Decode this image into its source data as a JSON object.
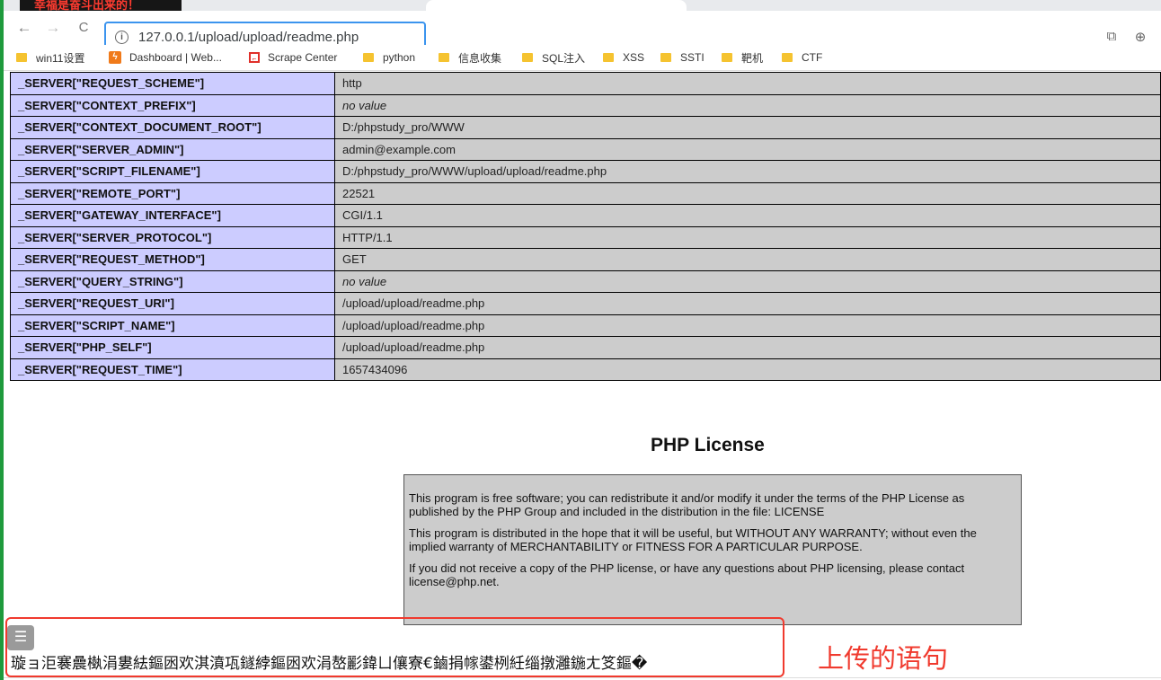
{
  "overlay_banner": "幸福是奋斗出来的！",
  "browser": {
    "url": "127.0.0.1/upload/upload/readme.php",
    "bookmarks": [
      {
        "label": "win11设置",
        "icon": "folder-icon"
      },
      {
        "label": "Dashboard | Web...",
        "icon": "dashboard-icon"
      },
      {
        "label": "Scrape Center",
        "icon": "scrape-icon"
      },
      {
        "label": "python",
        "icon": "folder-icon"
      },
      {
        "label": "信息收集",
        "icon": "folder-icon"
      },
      {
        "label": "SQL注入",
        "icon": "folder-icon"
      },
      {
        "label": "XSS",
        "icon": "folder-icon"
      },
      {
        "label": "SSTI",
        "icon": "folder-icon"
      },
      {
        "label": "靶机",
        "icon": "folder-icon"
      },
      {
        "label": "CTF",
        "icon": "folder-icon"
      }
    ]
  },
  "server_rows": [
    {
      "key": "_SERVER[\"REQUEST_SCHEME\"]",
      "value": "http"
    },
    {
      "key": "_SERVER[\"CONTEXT_PREFIX\"]",
      "value": "no value"
    },
    {
      "key": "_SERVER[\"CONTEXT_DOCUMENT_ROOT\"]",
      "value": "D:/phpstudy_pro/WWW"
    },
    {
      "key": "_SERVER[\"SERVER_ADMIN\"]",
      "value": "admin@example.com"
    },
    {
      "key": "_SERVER[\"SCRIPT_FILENAME\"]",
      "value": "D:/phpstudy_pro/WWW/upload/upload/readme.php"
    },
    {
      "key": "_SERVER[\"REMOTE_PORT\"]",
      "value": "22521"
    },
    {
      "key": "_SERVER[\"GATEWAY_INTERFACE\"]",
      "value": "CGI/1.1"
    },
    {
      "key": "_SERVER[\"SERVER_PROTOCOL\"]",
      "value": "HTTP/1.1"
    },
    {
      "key": "_SERVER[\"REQUEST_METHOD\"]",
      "value": "GET"
    },
    {
      "key": "_SERVER[\"QUERY_STRING\"]",
      "value": "no value"
    },
    {
      "key": "_SERVER[\"REQUEST_URI\"]",
      "value": "/upload/upload/readme.php"
    },
    {
      "key": "_SERVER[\"SCRIPT_NAME\"]",
      "value": "/upload/upload/readme.php"
    },
    {
      "key": "_SERVER[\"PHP_SELF\"]",
      "value": "/upload/upload/readme.php"
    },
    {
      "key": "_SERVER[\"REQUEST_TIME\"]",
      "value": "1657434096"
    }
  ],
  "license": {
    "title": "PHP License",
    "paragraphs": [
      "This program is free software; you can redistribute it and/or modify it under the terms of the PHP License as published by the PHP Group and included in the distribution in the file: LICENSE",
      "This program is distributed in the hope that it will be useful, but WITHOUT ANY WARRANTY; without even the implied warranty of MERCHANTABILITY or FITNESS FOR A PARTICULAR PURPOSE.",
      "If you did not receive a copy of the PHP license, or have any questions about PHP licensing, please contact license@php.net."
    ]
  },
  "garbled_output": "璇ョ洰褰曟槸涓婁紶鏂囦欢淇濆瓨鐩綍鏂囦欢涓嶅彲鍏ㄩ儴寮€鏀捐幏鍙栵紝缁撴灉鍦ㄤ笅鏂�",
  "annotation": "上传的语句",
  "colors": {
    "key_cell": "#ccccff",
    "value_cell": "#cccccc",
    "highlight_red": "#f03a2e",
    "address_border": "#3b94ee"
  }
}
